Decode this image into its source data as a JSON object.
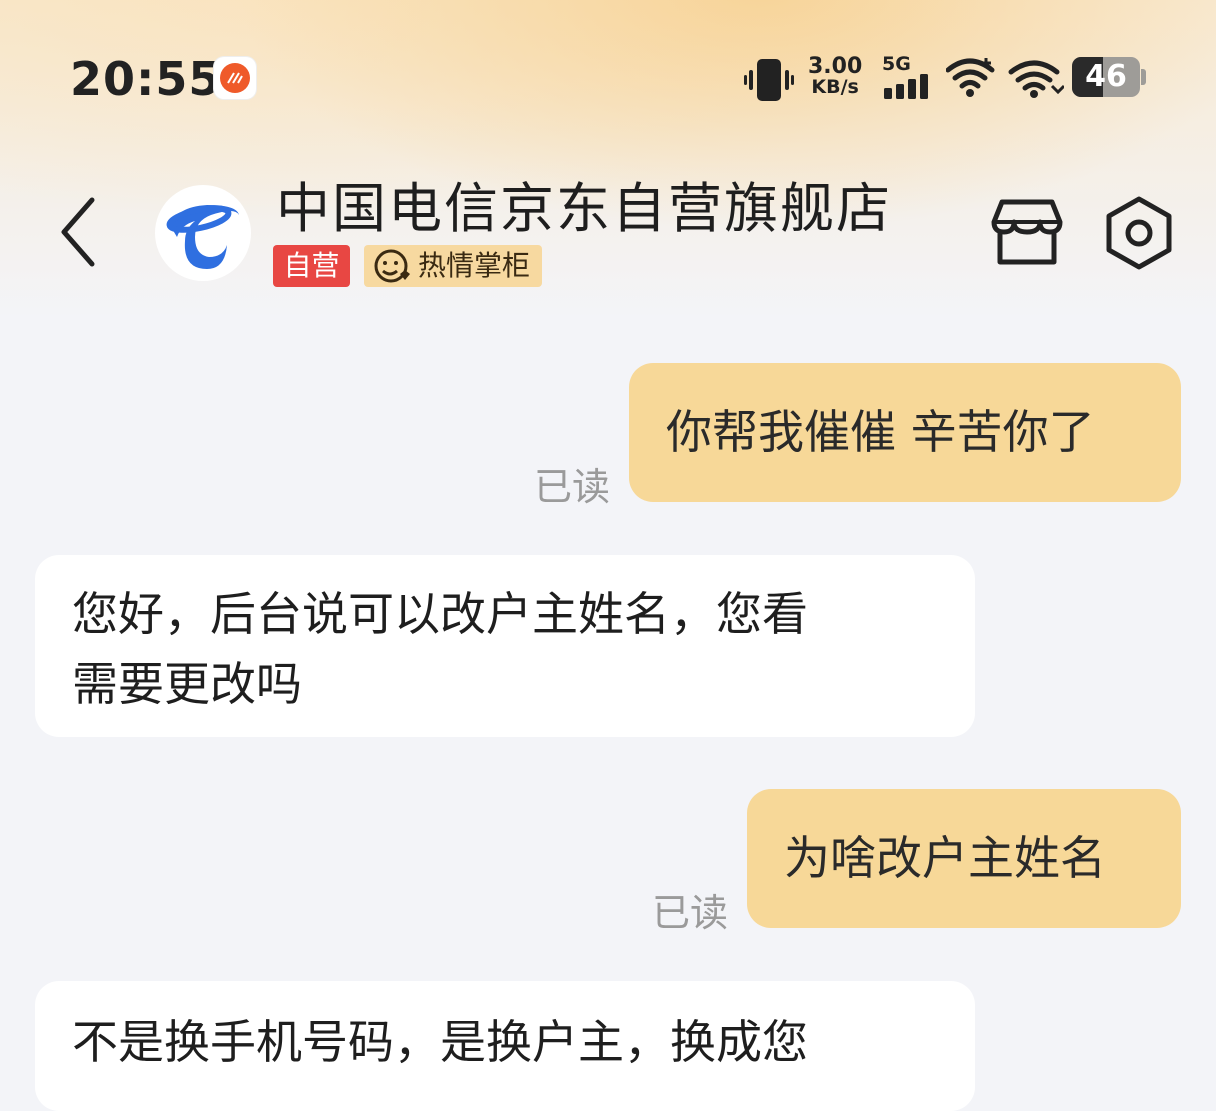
{
  "status_bar": {
    "time": "20:55",
    "net_speed_value": "3.00",
    "net_speed_unit": "KB/s",
    "network_type": "5G",
    "battery_level": "46",
    "battery_fraction": 0.46
  },
  "header": {
    "shop_name": "中国电信京东自营旗舰店",
    "tag_self_operated": "自营",
    "tag_host": "热情掌柜",
    "icons": [
      "back-icon",
      "store-icon",
      "settings-icon"
    ]
  },
  "messages": [
    {
      "direction": "out",
      "text": "你帮我催催 辛苦你了",
      "status": "已读"
    },
    {
      "direction": "in",
      "text_lines": [
        "您好，后台说可以改户主姓名，您看",
        "需要更改吗"
      ]
    },
    {
      "direction": "out",
      "text": "为啥改户主姓名",
      "status": "已读"
    },
    {
      "direction": "in",
      "text_lines": [
        "不是换手机号码，是换户主，换成您"
      ]
    }
  ],
  "colors": {
    "outgoing_bubble": "#f7d898",
    "incoming_bubble": "#ffffff",
    "tag_self": "#e84743",
    "tag_host": "#f7d9a0",
    "background": "#f3f4f8"
  }
}
